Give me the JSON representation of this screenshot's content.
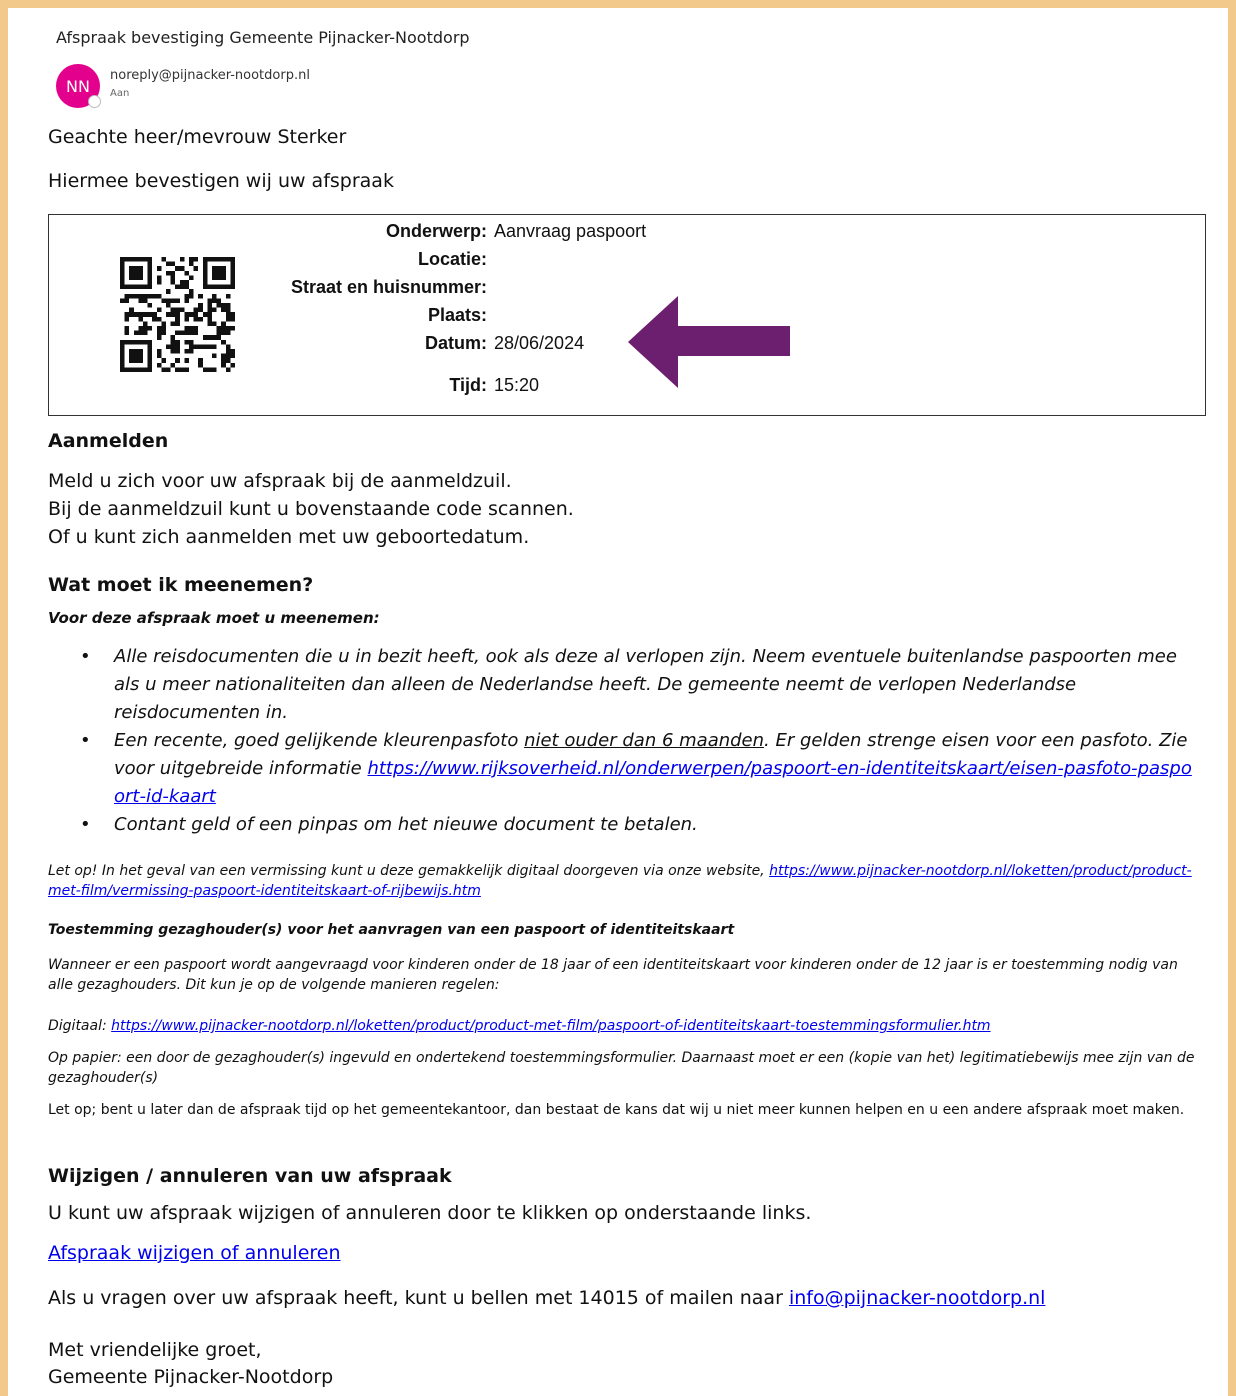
{
  "email": {
    "subject": "Afspraak bevestiging Gemeente Pijnacker-Nootdorp",
    "avatar_initials": "NN",
    "avatar_color": "#e3008c",
    "sender": "noreply@pijnacker-nootdorp.nl",
    "to_label": "Aan"
  },
  "body": {
    "greeting": "Geachte heer/mevrouw Sterker",
    "intro": "Hiermee bevestigen wij uw afspraak",
    "appointment": {
      "onderwerp_label": "Onderwerp:",
      "onderwerp_value": "Aanvraag paspoort",
      "locatie_label": "Locatie:",
      "straat_label": "Straat en huisnummer:",
      "plaats_label": "Plaats:",
      "datum_label": "Datum:",
      "datum_value": "28/06/2024",
      "tijd_label": "Tijd:",
      "tijd_value": "15:20"
    },
    "arrow_color": "#6b1f6e",
    "aanmelden": {
      "heading": "Aanmelden",
      "line1": "Meld u zich voor uw afspraak bij de aanmeldzuil.",
      "line2": "Bij de aanmeldzuil kunt u bovenstaande code scannen.",
      "line3": "Of u kunt zich aanmelden met uw geboortedatum."
    },
    "meenemen": {
      "heading": "Wat moet ik meenemen?",
      "sub": "Voor deze afspraak moet u meenemen:",
      "b1": "Alle reisdocumenten die u in bezit heeft, ook als deze al verlopen zijn. Neem eventuele buitenlandse paspoorten mee als u meer nationaliteiten dan alleen de Nederlandse heeft. De gemeente neemt de verlopen Nederlandse reisdocumenten in.",
      "b2_a": "Een recente, goed gelijkende kleurenpasfoto ",
      "b2_u": "niet ouder dan 6 maanden",
      "b2_b": ". Er gelden strenge eisen voor een pasfoto. Zie voor uitgebreide informatie ",
      "b2_link": "https://www.rijksoverheid.nl/onderwerpen/paspoort-en-identiteitskaart/eisen-pasfoto-paspoort-id-kaart",
      "b3": "Contant geld of een pinpas om het nieuwe document te betalen."
    },
    "letop": {
      "text": "Let op! In het geval van een vermissing kunt u deze gemakkelijk digitaal doorgeven via onze website, ",
      "link": "https://www.pijnacker-nootdorp.nl/loketten/product/product-met-film/vermissing-paspoort-identiteitskaart-of-rijbewijs.htm"
    },
    "toestemming": {
      "heading": "Toestemming gezaghouder(s) voor het aanvragen van een paspoort of identiteitskaart",
      "text": "Wanneer er een paspoort wordt aangevraagd voor kinderen onder de 18 jaar of een identiteitskaart voor kinderen onder de 12 jaar is er toestemming nodig van alle gezaghouders. Dit kun je op de volgende manieren regelen:",
      "digitaal_label": "Digitaal: ",
      "digitaal_link": "https://www.pijnacker-nootdorp.nl/loketten/product/product-met-film/paspoort-of-identiteitskaart-toestemmingsformulier.htm",
      "papier": "Op papier: een door de gezaghouder(s) ingevuld en ondertekend toestemmingsformulier. Daarnaast moet er een (kopie van het) legitimatiebewijs mee zijn van de gezaghouder(s)"
    },
    "laat": "Let op; bent u later dan de afspraak tijd op het gemeentekantoor, dan bestaat de kans dat wij u niet meer kunnen helpen en u een andere afspraak moet maken.",
    "wijzigen": {
      "heading": "Wijzigen / annuleren van uw afspraak",
      "text": "U kunt uw afspraak wijzigen of annuleren door te klikken op onderstaande links.",
      "link": "Afspraak wijzigen of annuleren"
    },
    "contact": {
      "text": "Als u vragen over uw afspraak heeft, kunt u bellen met 14015 of mailen naar ",
      "email": "info@pijnacker-nootdorp.nl"
    },
    "closing1": "Met vriendelijke groet,",
    "closing2": "Gemeente Pijnacker-Nootdorp"
  }
}
